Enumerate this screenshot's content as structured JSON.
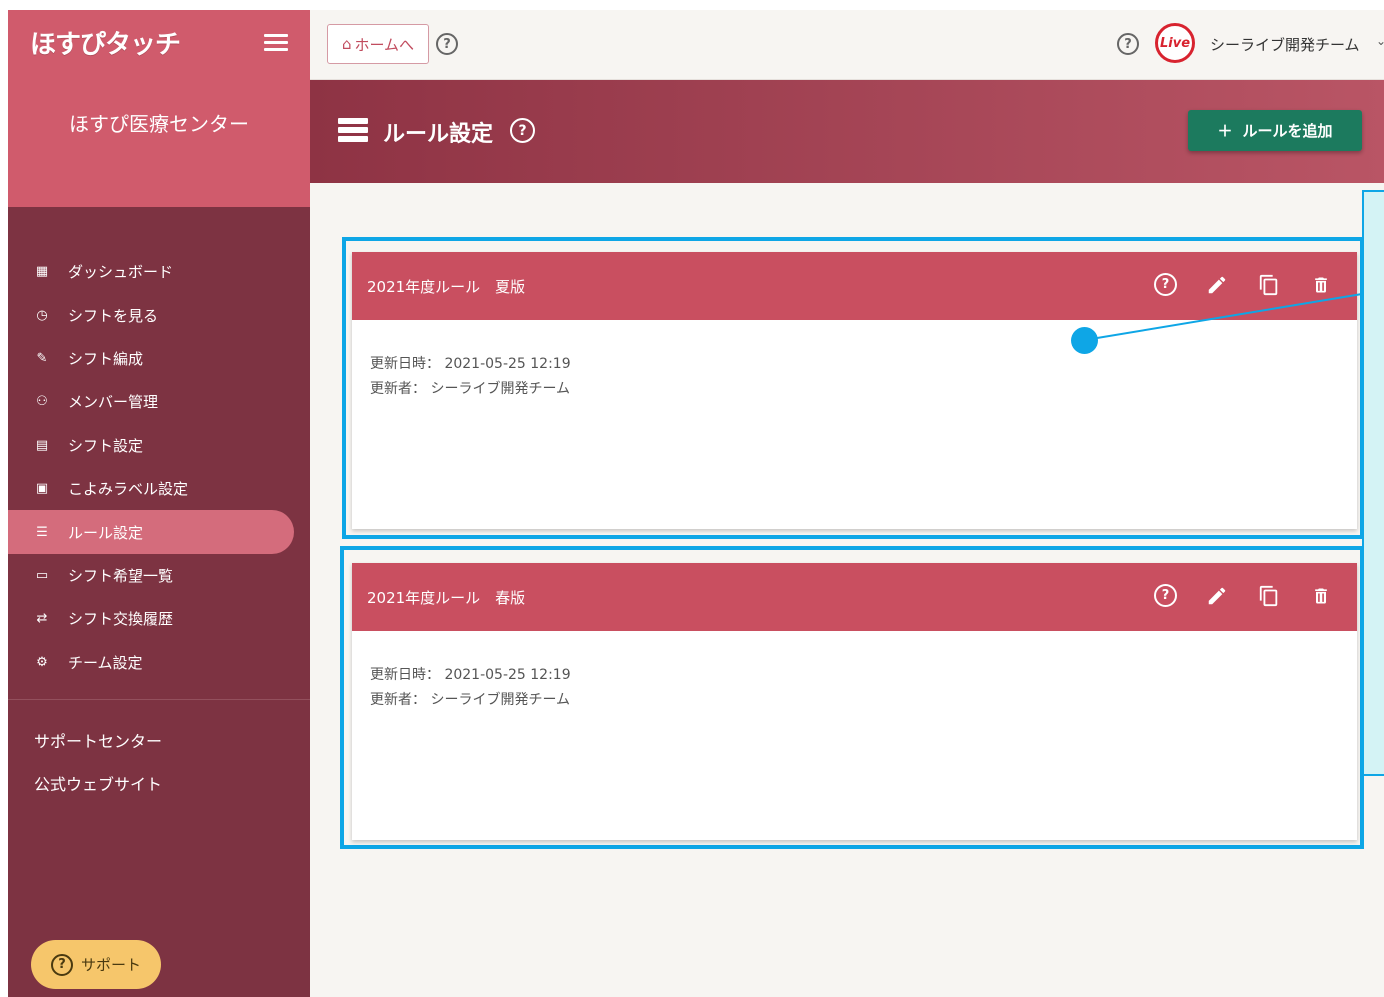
{
  "sidebar": {
    "logo_text": "ほすぴタッチ",
    "org_name": "ほすぴ医療センター",
    "items": [
      {
        "icon": "dashboard-icon",
        "glyph": "▦",
        "label": "ダッシュボード"
      },
      {
        "icon": "clock-icon",
        "glyph": "◷",
        "label": "シフトを見る"
      },
      {
        "icon": "wrench-icon",
        "glyph": "✎",
        "label": "シフト編成"
      },
      {
        "icon": "people-icon",
        "glyph": "⚇",
        "label": "メンバー管理"
      },
      {
        "icon": "clipboard-icon",
        "glyph": "▤",
        "label": "シフト設定"
      },
      {
        "icon": "calendar-icon",
        "glyph": "▣",
        "label": "こよみラベル設定"
      },
      {
        "icon": "list-icon",
        "glyph": "☰",
        "label": "ルール設定"
      },
      {
        "icon": "message-icon",
        "glyph": "▭",
        "label": "シフト希望一覧"
      },
      {
        "icon": "swap-icon",
        "glyph": "⇄",
        "label": "シフト交換履歴"
      },
      {
        "icon": "gear-icon",
        "glyph": "⚙",
        "label": "チーム設定"
      }
    ],
    "active_index": 6,
    "links": [
      "サポートセンター",
      "公式ウェブサイト"
    ],
    "support_label": "サポート"
  },
  "topbar": {
    "home_label": "ホームへ",
    "team_name": "シーライブ開発チーム",
    "live_logo_text": "Live"
  },
  "header": {
    "title": "ルール設定",
    "add_button": "ルールを追加"
  },
  "rules": [
    {
      "title": "2021年度ルール　夏版",
      "updated_label": "更新日時：",
      "updated_value": "2021-05-25 12:19",
      "updater_label": "更新者：",
      "updater_value": "シーライブ開発チーム"
    },
    {
      "title": "2021年度ルール　春版",
      "updated_label": "更新日時：",
      "updated_value": "2021-05-25 12:19",
      "updater_label": "更新者：",
      "updater_value": "シーライブ開発チーム"
    }
  ],
  "colors": {
    "sidebar_bg": "#7d3342",
    "sidebar_top": "#d05b6c",
    "card_header": "#c94f60",
    "add_button": "#1c7a5e",
    "highlight": "#0ea6e6"
  }
}
